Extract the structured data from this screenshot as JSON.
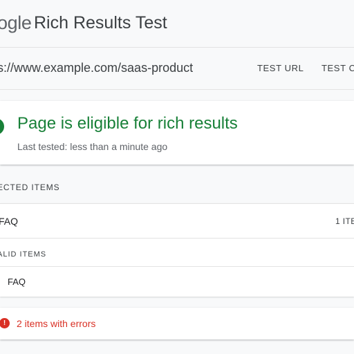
{
  "header": {
    "logo_text": "ogle",
    "title": "Rich Results Test"
  },
  "urlbar": {
    "url": "s://www.example.com/saas-product",
    "tab_url": "TEST URL",
    "tab_code": "TEST C"
  },
  "status": {
    "title": "Page is eligible for rich results",
    "subtitle": "Last tested: less than a minute ago",
    "icon": "check-circle-icon",
    "color": "#188038"
  },
  "detected": {
    "label": "ECTED ITEMS",
    "items": [
      {
        "name": "FAQ",
        "count": "1 ITE"
      }
    ]
  },
  "invalid": {
    "label": "ALID ITEMS",
    "items": [
      {
        "name": "FAQ"
      }
    ]
  },
  "errors": {
    "icon_glyph": "!",
    "text": "2 items with errors",
    "color": "#d93025"
  }
}
